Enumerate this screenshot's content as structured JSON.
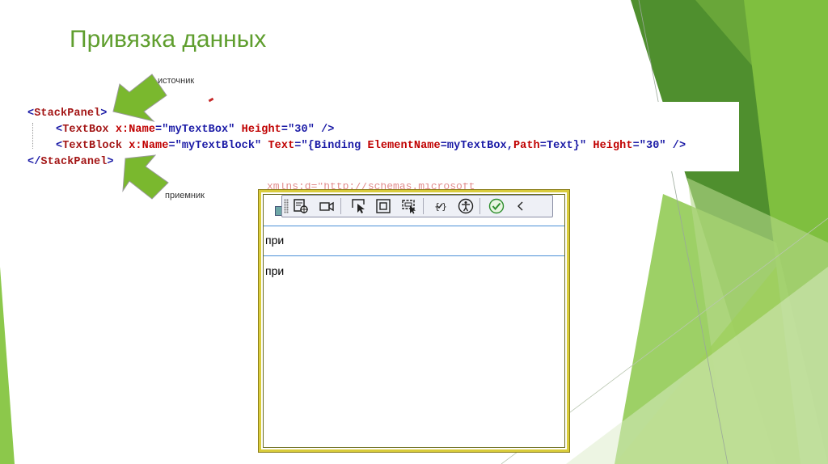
{
  "slide": {
    "title": "Привязка данных"
  },
  "callouts": {
    "source": "источник",
    "receiver": "приемник"
  },
  "code": {
    "line1": {
      "open": "<",
      "tag": "StackPanel",
      "close": ">"
    },
    "line2": {
      "open": "<",
      "tag": "TextBox",
      "attr1": " x:Name",
      "eq1": "=",
      "val1": "\"myTextBox\"",
      "attr2": " Height",
      "eq2": "=",
      "val2": "\"30\"",
      "close": " />"
    },
    "line3": {
      "open": "<",
      "tag": "TextBlock",
      "attr1": " x:Name",
      "eq1": "=",
      "val1": "\"myTextBlock\"",
      "attr2": " Text",
      "eq2": "=",
      "val2a": "\"{Binding ",
      "attr3": "ElementName",
      "val2b": "=myTextBox,",
      "attr4": "Path",
      "val2c": "=Text}\"",
      "attr5": " Height",
      "eq5": "=",
      "val5": "\"30\"",
      "close": " />"
    },
    "line4": {
      "open": "</",
      "tag": "StackPanel",
      "close": ">"
    }
  },
  "background_code": "xmlns:d=\"http://schemas.microsoft",
  "app_window": {
    "toolbar": {
      "buttons": [
        {
          "icon": "live-visual-tree-icon"
        },
        {
          "icon": "video-camera-icon"
        },
        {
          "icon": "select-element-icon"
        },
        {
          "icon": "display-layout-adorners-icon"
        },
        {
          "icon": "track-focus-icon"
        },
        {
          "icon": "binding-failures-icon"
        },
        {
          "icon": "accessibility-icon"
        },
        {
          "icon": "check-circle-icon"
        },
        {
          "icon": "collapse-chevron-icon"
        }
      ]
    },
    "textbox_value": "при",
    "textblock_value": "при"
  },
  "colors": {
    "title": "#5f9e2e",
    "arrow_green": "#7ab82e",
    "decor_green_dark": "#4a8a2a",
    "decor_green_light": "#c9e2a8",
    "window_border": "#d9cc3b",
    "textbox_border": "#4a8fd6"
  }
}
